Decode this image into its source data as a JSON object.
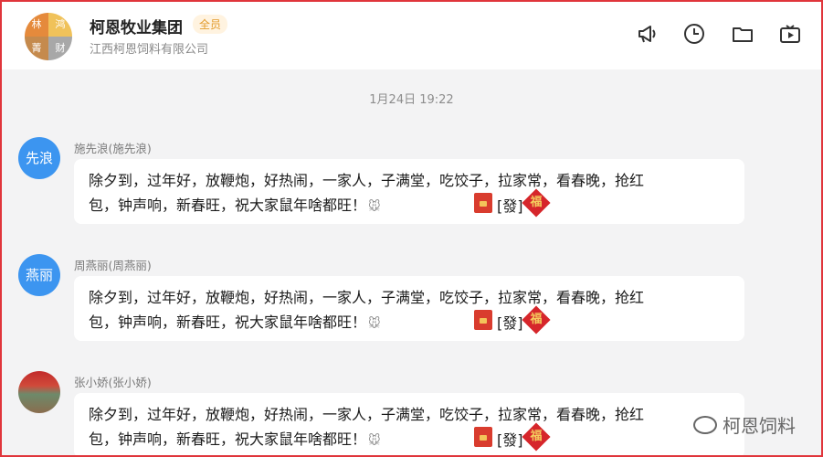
{
  "header": {
    "group_name": "柯恩牧业集团",
    "badge": "全员",
    "subtitle": "江西柯恩饲料有限公司",
    "avatar_chars": [
      "林",
      "鸿",
      "菁",
      "财"
    ],
    "icons": [
      "megaphone-icon",
      "clock-icon",
      "folder-icon",
      "video-icon"
    ]
  },
  "chat": {
    "timestamp": "1月24日 19:22",
    "messages": [
      {
        "avatar_text": "先浪",
        "sender": "施先浪(施先浪)",
        "line1": "除夕到，过年好，放鞭炮，好热闹，一家人，子满堂，吃饺子，拉家常，看春晚，抢红",
        "line2": "包，钟声响，新春旺，祝大家鼠年啥都旺！",
        "redpacket_label": "[發]",
        "fu": "福"
      },
      {
        "avatar_text": "燕丽",
        "sender": "周燕丽(周燕丽)",
        "line1": "除夕到，过年好，放鞭炮，好热闹，一家人，子满堂，吃饺子，拉家常，看春晚，抢红",
        "line2": "包，钟声响，新春旺，祝大家鼠年啥都旺！",
        "redpacket_label": "[發]",
        "fu": "福"
      },
      {
        "avatar_text": "",
        "sender": "张小娇(张小娇)",
        "line1": "除夕到，过年好，放鞭炮，好热闹，一家人，子满堂，吃饺子，拉家常，看春晚，抢红",
        "line2": "包，钟声响，新春旺，祝大家鼠年啥都旺！",
        "redpacket_label": "[發]",
        "fu": "福"
      }
    ]
  },
  "watermark": "柯恩饲料"
}
